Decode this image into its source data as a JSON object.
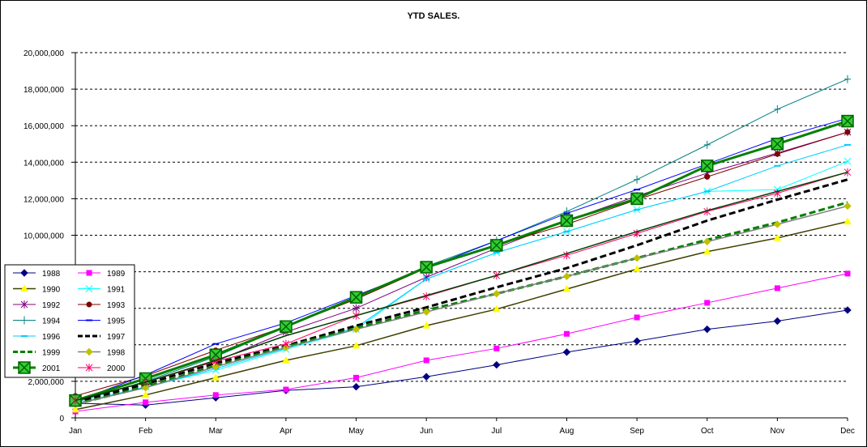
{
  "chart_data": {
    "type": "line",
    "title": "YTD SALES.",
    "xlabel": "",
    "ylabel": "",
    "ylim": [
      0,
      20000000
    ],
    "y_ticks": [
      "0",
      "2,000,000",
      "",
      "",
      "",
      "10,000,000",
      "12,000,000",
      "14,000,000",
      "16,000,000",
      "18,000,000",
      "20,000,000"
    ],
    "y_tick_values": [
      0,
      2000000,
      4000000,
      6000000,
      8000000,
      10000000,
      12000000,
      14000000,
      16000000,
      18000000,
      20000000
    ],
    "grid": "horizontal-dashed",
    "legend_position": "left",
    "categories": [
      "Jan",
      "Feb",
      "Mar",
      "Apr",
      "May",
      "Jun",
      "Jul",
      "Aug",
      "Sep",
      "Oct",
      "Nov",
      "Dec"
    ],
    "series": [
      {
        "name": "1988",
        "color": "#000080",
        "marker": "diamond",
        "values": [
          800000,
          700000,
          1100000,
          1500000,
          1700000,
          2250000,
          2900000,
          3600000,
          4200000,
          4850000,
          5300000,
          5900000
        ]
      },
      {
        "name": "1989",
        "color": "#ff00ff",
        "marker": "square",
        "values": [
          350000,
          850000,
          1250000,
          1550000,
          2200000,
          3150000,
          3800000,
          4600000,
          5500000,
          6300000,
          7100000,
          7900000
        ]
      },
      {
        "name": "1990",
        "color": "#ffff00",
        "marker": "triangle",
        "values": [
          450000,
          1250000,
          2200000,
          3150000,
          3950000,
          5050000,
          5950000,
          7050000,
          8150000,
          9100000,
          9850000,
          10750000
        ]
      },
      {
        "name": "1991",
        "color": "#00ffff",
        "marker": "x",
        "values": [
          800000,
          1700000,
          2600000,
          3750000,
          4850000,
          7600000,
          9050000,
          10200000,
          11400000,
          12400000,
          12500000,
          14050000
        ]
      },
      {
        "name": "1992",
        "color": "#800080",
        "marker": "star",
        "values": [
          900000,
          1950000,
          3100000,
          4700000,
          6000000,
          7700000,
          9300000,
          10800000,
          12150000,
          13400000,
          14500000,
          15650000
        ]
      },
      {
        "name": "1993",
        "color": "#800000",
        "marker": "circle",
        "values": [
          1200000,
          2300000,
          3700000,
          5000000,
          6500000,
          8200000,
          9450000,
          10600000,
          11950000,
          13200000,
          14450000,
          15650000
        ]
      },
      {
        "name": "1994",
        "color": "#008080",
        "marker": "plus",
        "values": [
          850000,
          2000000,
          3350000,
          5000000,
          6600000,
          8300000,
          9700000,
          11300000,
          13050000,
          14950000,
          16900000,
          18550000
        ]
      },
      {
        "name": "1995",
        "color": "#0000ff",
        "marker": "dash",
        "values": [
          900000,
          2350000,
          4050000,
          5200000,
          6700000,
          8200000,
          9700000,
          11200000,
          12500000,
          13900000,
          15300000,
          16400000
        ]
      },
      {
        "name": "1996",
        "color": "#00ccff",
        "marker": "dash",
        "values": [
          750000,
          1650000,
          2700000,
          3800000,
          4950000,
          7600000,
          9050000,
          10200000,
          11400000,
          12400000,
          13800000,
          14950000
        ]
      },
      {
        "name": "1997",
        "color": "#000000",
        "marker": "none",
        "values": [
          850000,
          1850000,
          3000000,
          3950000,
          5050000,
          6050000,
          7150000,
          8200000,
          9450000,
          10800000,
          11950000,
          13050000
        ]
      },
      {
        "name": "1999",
        "color": "#008000",
        "marker": "none",
        "values": [
          750000,
          1700000,
          2850000,
          3900000,
          4900000,
          5900000,
          6800000,
          7750000,
          8750000,
          9750000,
          10700000,
          11800000
        ]
      },
      {
        "name": "1998",
        "color": "#c0c000",
        "marker": "diamond",
        "values": [
          750000,
          1650000,
          2800000,
          3850000,
          4850000,
          5800000,
          6800000,
          7750000,
          8750000,
          9650000,
          10600000,
          11600000
        ]
      },
      {
        "name": "2001",
        "color": "#008000",
        "marker": "box-x",
        "values": [
          950000,
          2150000,
          3450000,
          5000000,
          6600000,
          8250000,
          9450000,
          10800000,
          12000000,
          13800000,
          15000000,
          16250000
        ]
      },
      {
        "name": "2000",
        "color": "#ff0066",
        "marker": "star",
        "values": [
          950000,
          1950000,
          3100000,
          4050000,
          5600000,
          6650000,
          7800000,
          8900000,
          10100000,
          11300000,
          12300000,
          13450000
        ]
      },
      {
        "name": "",
        "color": "#004000",
        "marker": "none",
        "values": [
          950000,
          1950000,
          3150000,
          4500000,
          5600000,
          6700000,
          7800000,
          9000000,
          10200000,
          11350000,
          12400000,
          13450000
        ]
      }
    ],
    "legend_rows": [
      [
        "1988",
        "1989"
      ],
      [
        "1990",
        "1991"
      ],
      [
        "1992",
        "1993"
      ],
      [
        "1994",
        "1995"
      ],
      [
        "1996",
        "1997"
      ],
      [
        "1999",
        "1998"
      ],
      [
        "2001",
        "2000"
      ]
    ]
  }
}
